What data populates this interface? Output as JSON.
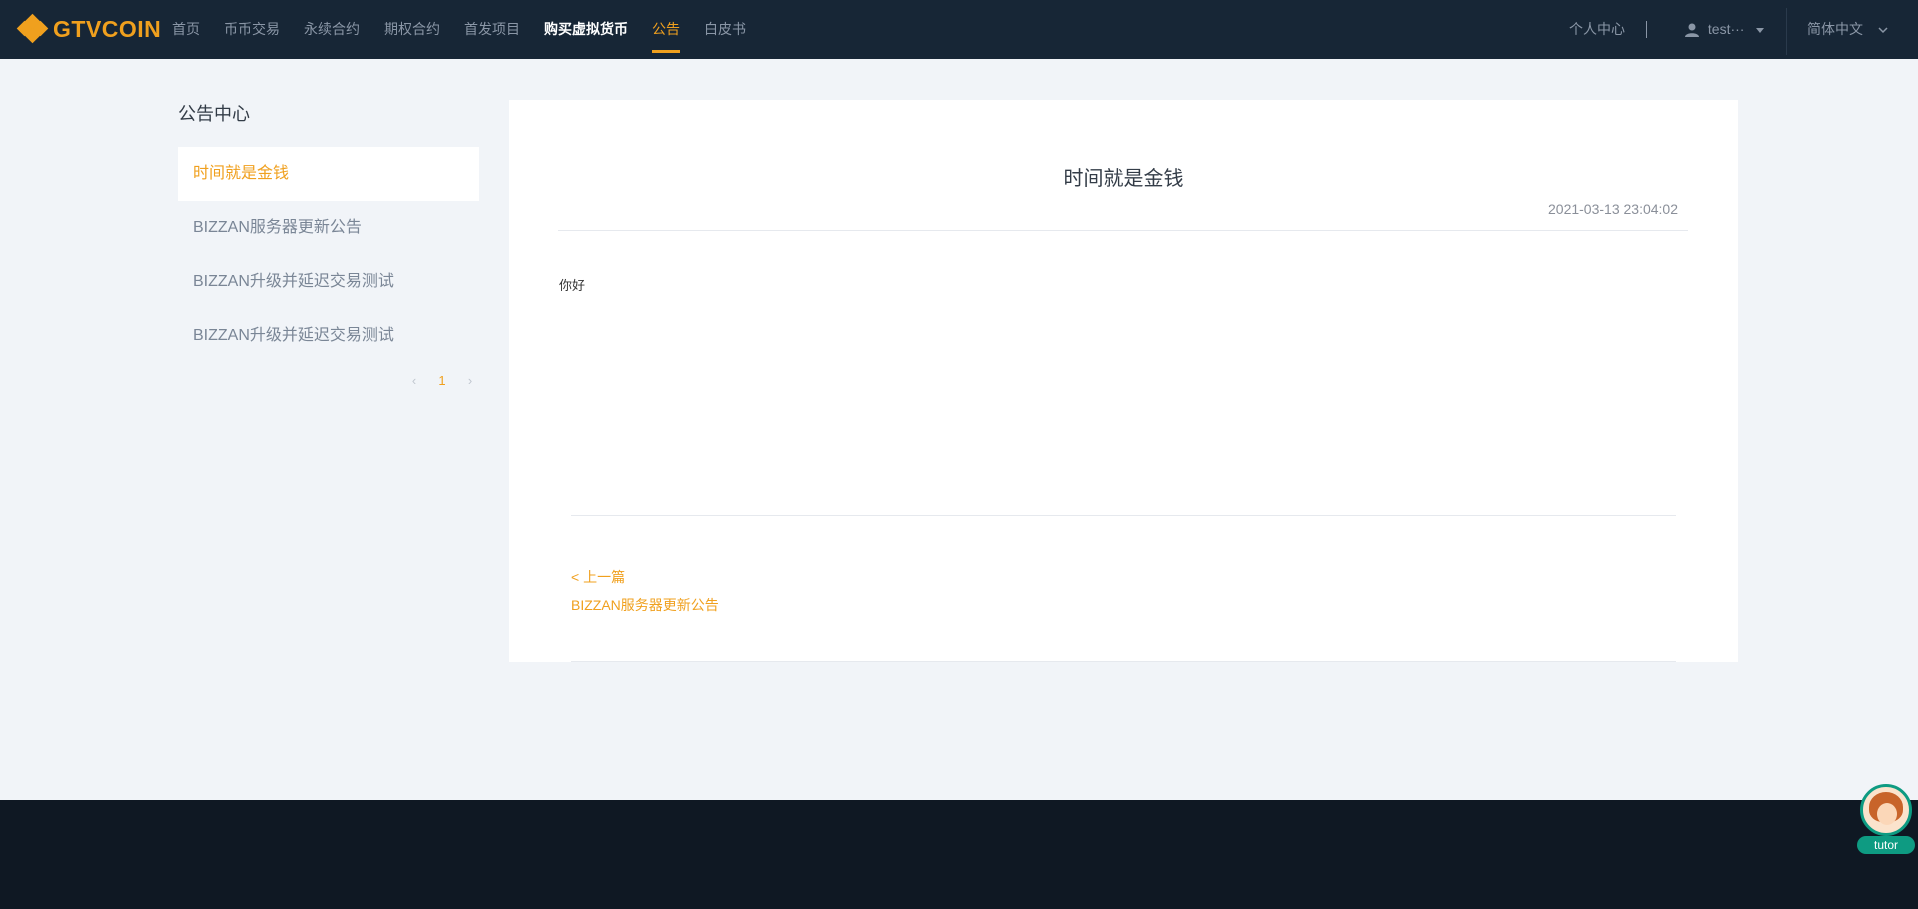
{
  "header": {
    "logo_text": "GTVCOIN",
    "nav": [
      {
        "label": "首页"
      },
      {
        "label": "币币交易"
      },
      {
        "label": "永续合约"
      },
      {
        "label": "期权合约"
      },
      {
        "label": "首发项目"
      },
      {
        "label": "购买虚拟货币"
      },
      {
        "label": "公告"
      },
      {
        "label": "白皮书"
      }
    ],
    "active_nav": "公告",
    "personal_center": "个人中心",
    "user_name": "test···",
    "language": "简体中文"
  },
  "sidebar": {
    "title": "公告中心",
    "items": [
      {
        "label": "时间就是金钱",
        "active": true
      },
      {
        "label": "BIZZAN服务器更新公告"
      },
      {
        "label": "BIZZAN升级并延迟交易测试"
      },
      {
        "label": "BIZZAN升级并延迟交易测试"
      }
    ],
    "pagination": {
      "prev": "‹",
      "current": "1",
      "next": "›"
    }
  },
  "article": {
    "title": "时间就是金钱",
    "date": "2021-03-13 23:04:02",
    "body": "你好",
    "prev_label": "< 上一篇",
    "prev_title": "BIZZAN服务器更新公告"
  },
  "widget": {
    "label": "tutor"
  },
  "colors": {
    "accent": "#f0a01e",
    "header_bg": "#172636",
    "footer_bg": "#0f1823",
    "page_bg": "#f1f4f8"
  }
}
